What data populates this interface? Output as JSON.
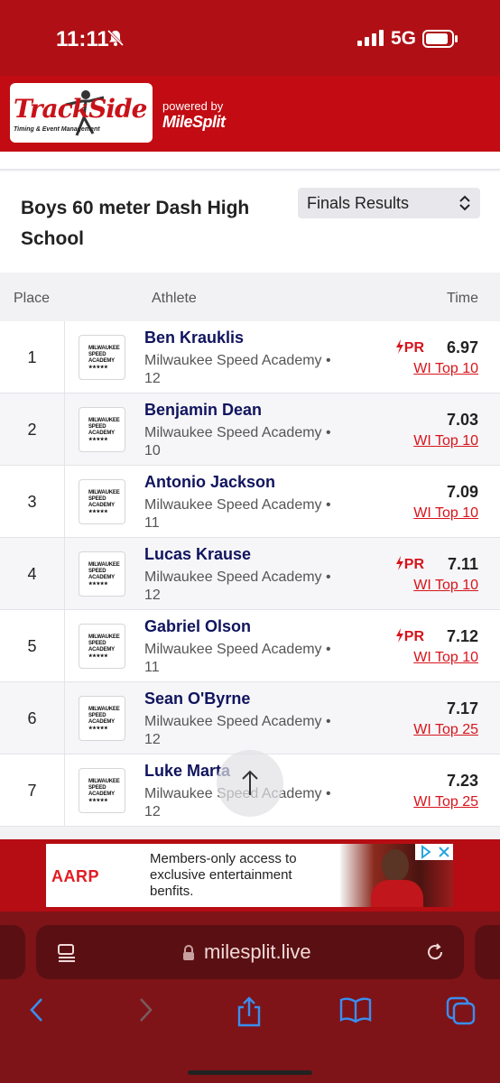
{
  "status_bar": {
    "time": "11:11",
    "network": "5G"
  },
  "brand": {
    "logo_text": "TrackSide",
    "logo_subtext": "Timing & Event Management",
    "powered_by": "powered by",
    "partner": "MileSplit"
  },
  "event": {
    "title": "Boys 60 meter Dash High School",
    "results_select": "Finals Results"
  },
  "columns": {
    "place": "Place",
    "athlete": "Athlete",
    "time": "Time"
  },
  "team_logo_text": [
    "MILWAUKEE",
    "SPEED",
    "ACADEMY",
    "★★★★★"
  ],
  "results": [
    {
      "place": "1",
      "name": "Ben Krauklis",
      "school": "Milwaukee Speed Academy •",
      "grade": "12",
      "time": "6.97",
      "pr": "PR",
      "rank": "WI Top 10"
    },
    {
      "place": "2",
      "name": "Benjamin Dean",
      "school": "Milwaukee Speed Academy •",
      "grade": "10",
      "time": "7.03",
      "pr": "",
      "rank": "WI Top 10"
    },
    {
      "place": "3",
      "name": "Antonio Jackson",
      "school": "Milwaukee Speed Academy •",
      "grade": "11",
      "time": "7.09",
      "pr": "",
      "rank": "WI Top 10"
    },
    {
      "place": "4",
      "name": "Lucas Krause",
      "school": "Milwaukee Speed Academy •",
      "grade": "12",
      "time": "7.11",
      "pr": "PR",
      "rank": "WI Top 10"
    },
    {
      "place": "5",
      "name": "Gabriel Olson",
      "school": "Milwaukee Speed Academy •",
      "grade": "11",
      "time": "7.12",
      "pr": "PR",
      "rank": "WI Top 10"
    },
    {
      "place": "6",
      "name": "Sean O'Byrne",
      "school": "Milwaukee Speed Academy •",
      "grade": "12",
      "time": "7.17",
      "pr": "",
      "rank": "WI Top 25"
    },
    {
      "place": "7",
      "name": "Luke Marta",
      "school": "Milwaukee Speed Academy •",
      "grade": "12",
      "time": "7.23",
      "pr": "",
      "rank": "WI Top 25"
    }
  ],
  "ad": {
    "brand": "AARP",
    "text": "Members-only access to exclusive entertainment benfits."
  },
  "browser": {
    "url": "milesplit.live"
  },
  "colors": {
    "header_red": "#c20b12",
    "accent_red": "#d7141c",
    "name_navy": "#10145e",
    "chrome": "#7e1418"
  }
}
